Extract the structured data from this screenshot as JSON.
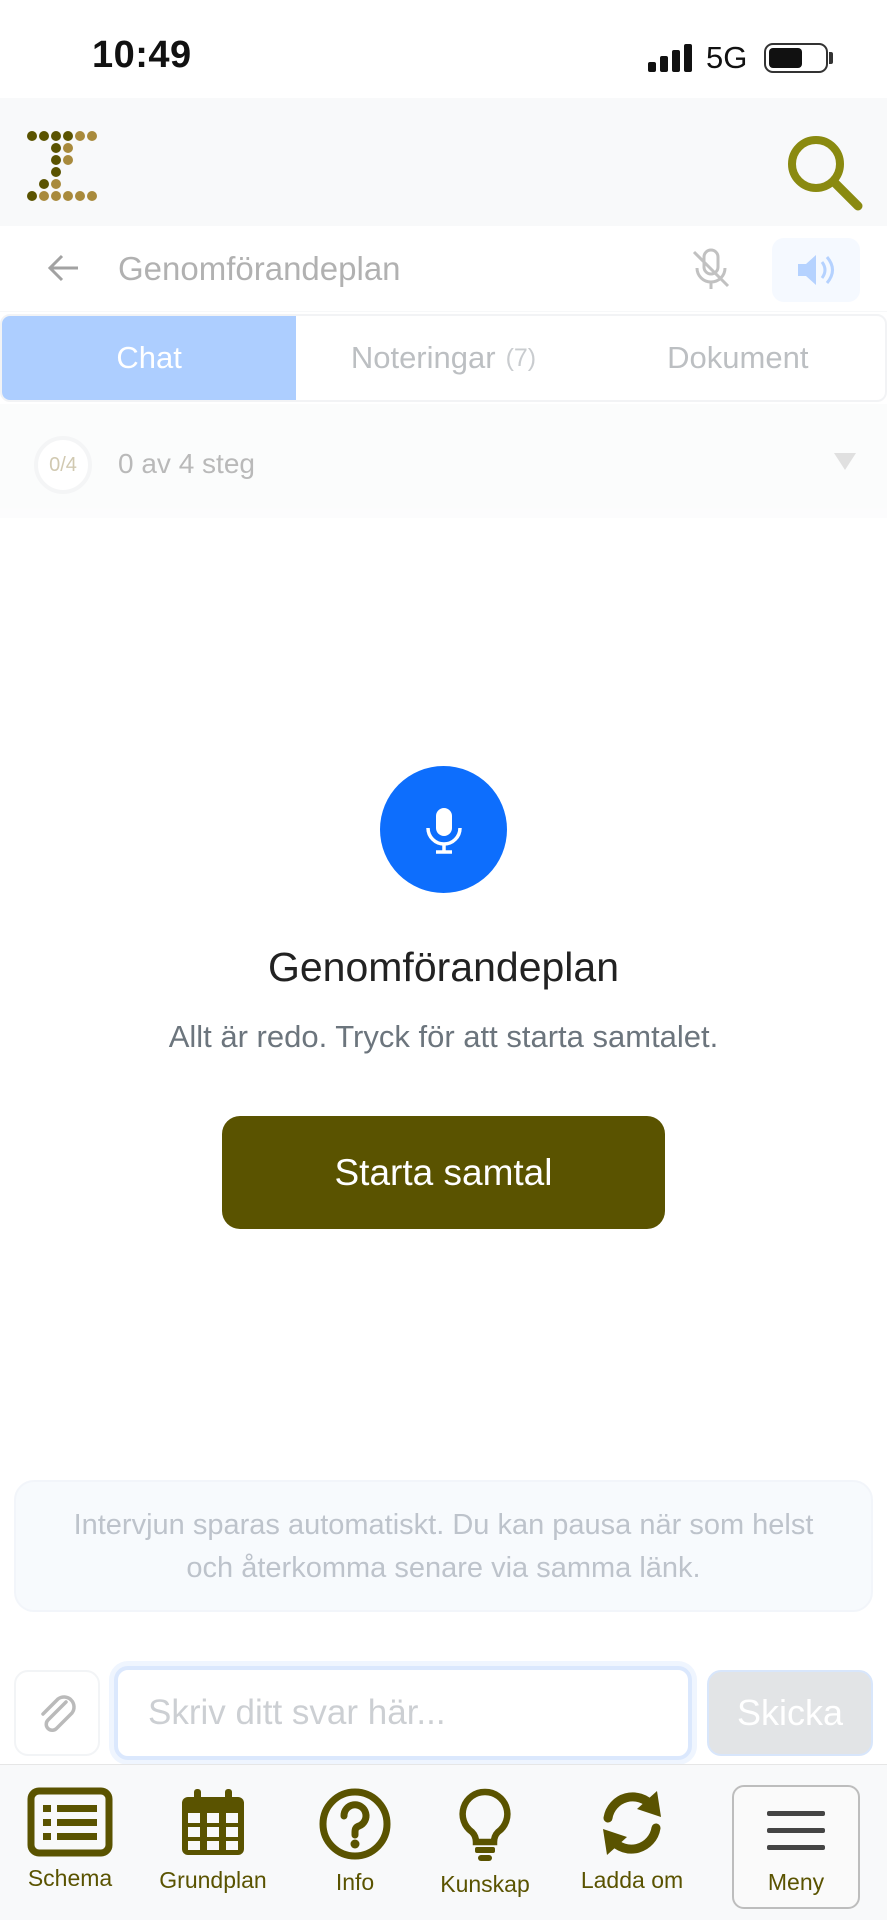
{
  "status_bar": {
    "time": "10:49",
    "network": "5G"
  },
  "chat": {
    "title": "Genomförandeplan"
  },
  "tabs": [
    {
      "label": "Chat",
      "active": true
    },
    {
      "label": "Noteringar",
      "count": "(7)"
    },
    {
      "label": "Dokument"
    }
  ],
  "steps": {
    "badge": "0/4",
    "text": "0 av 4 steg"
  },
  "start": {
    "title": "Genomförandeplan",
    "subtitle": "Allt är redo. Tryck för att starta samtalet.",
    "button": "Starta samtal"
  },
  "notice": {
    "line1": "Intervjun sparas automatiskt. Du kan pausa när som helst",
    "line2": "och återkomma senare via samma länk."
  },
  "composer": {
    "placeholder": "Skriv ditt svar här...",
    "send_label": "Skicka"
  },
  "bottom_nav": [
    {
      "label": "Schema",
      "icon": "list-icon"
    },
    {
      "label": "Grundplan",
      "icon": "calendar-icon"
    },
    {
      "label": "Info",
      "icon": "question-icon"
    },
    {
      "label": "Kunskap",
      "icon": "lightbulb-icon"
    },
    {
      "label": "Ladda om",
      "icon": "refresh-icon"
    },
    {
      "label": "Meny",
      "icon": "hamburger-icon"
    }
  ],
  "colors": {
    "brand": "#5a5300",
    "accent_blue": "#0d6efd",
    "search_icon": "#8a8a10"
  }
}
